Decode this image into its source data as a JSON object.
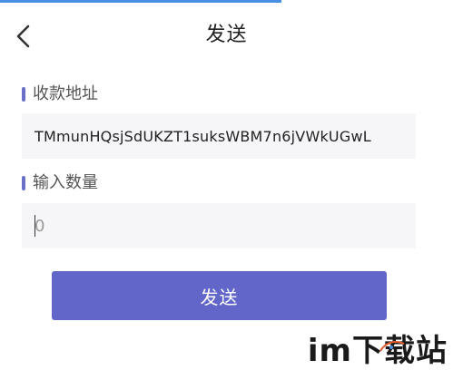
{
  "header": {
    "title": "发送",
    "back_icon": "chevron-left-icon"
  },
  "address_section": {
    "label": "收款地址",
    "value": "TMmunHQsjSdUKZT1suksWBM7n6jVWkUGwL"
  },
  "amount_section": {
    "label": "输入数量",
    "placeholder": "0"
  },
  "send_button": {
    "label": "发送"
  },
  "watermark": {
    "text": "im下载站"
  },
  "colors": {
    "accent": "#6266c9",
    "label_bar": "#6a6fc8",
    "field_bg": "#f6f6f8",
    "top_accent": "#4a90e2"
  }
}
